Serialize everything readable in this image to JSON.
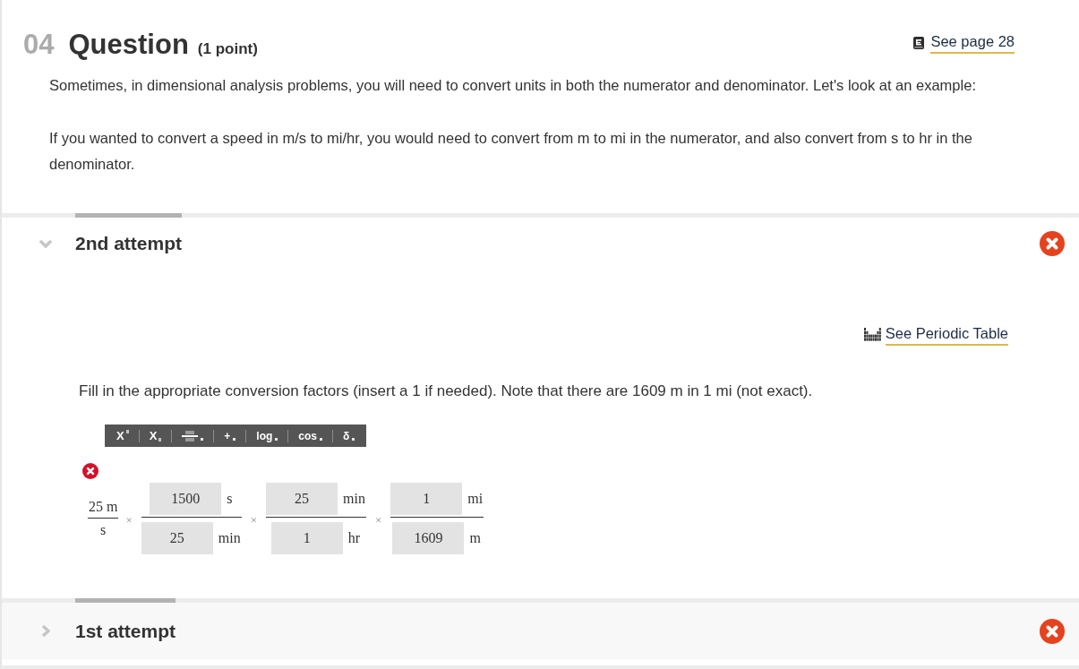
{
  "question": {
    "number": "04",
    "title": "Question",
    "points": "(1 point)",
    "reference_link": "See page 28",
    "paragraphs": [
      "Sometimes, in dimensional analysis problems, you will need to convert units in both the numerator and denominator. Let's look at an example:",
      "If you wanted to convert a speed in m/s to mi/hr, you would need to convert from m to mi in the numerator, and also convert from s to hr in the denominator."
    ]
  },
  "attempts": [
    {
      "label": "2nd attempt",
      "expanded": true,
      "correct": false,
      "periodic_table_link": "See Periodic Table",
      "instruction": "Fill in the appropriate conversion factors (insert a 1 if needed). Note that there are 1609 m in 1 mi (not exact).",
      "toolbar": [
        {
          "kind": "superscript",
          "label": "X"
        },
        {
          "kind": "subscript",
          "label": "X"
        },
        {
          "kind": "fraction"
        },
        {
          "kind": "menu",
          "label": "+"
        },
        {
          "kind": "menu",
          "label": "log"
        },
        {
          "kind": "menu",
          "label": "cos"
        },
        {
          "kind": "menu",
          "label": "δ"
        }
      ],
      "answer": {
        "correct": false,
        "given": {
          "numerator": "25 m",
          "denominator": "s"
        },
        "factors": [
          {
            "operator": "×",
            "numerator": {
              "value": "1500",
              "unit": "s"
            },
            "denominator": {
              "value": "25",
              "unit": "min"
            }
          },
          {
            "operator": "×",
            "numerator": {
              "value": "25",
              "unit": "min"
            },
            "denominator": {
              "value": "1",
              "unit": "hr"
            }
          },
          {
            "operator": "×",
            "numerator": {
              "value": "1",
              "unit": "mi"
            },
            "denominator": {
              "value": "1609",
              "unit": "m"
            }
          }
        ]
      }
    },
    {
      "label": "1st attempt",
      "expanded": false,
      "correct": false
    }
  ]
}
